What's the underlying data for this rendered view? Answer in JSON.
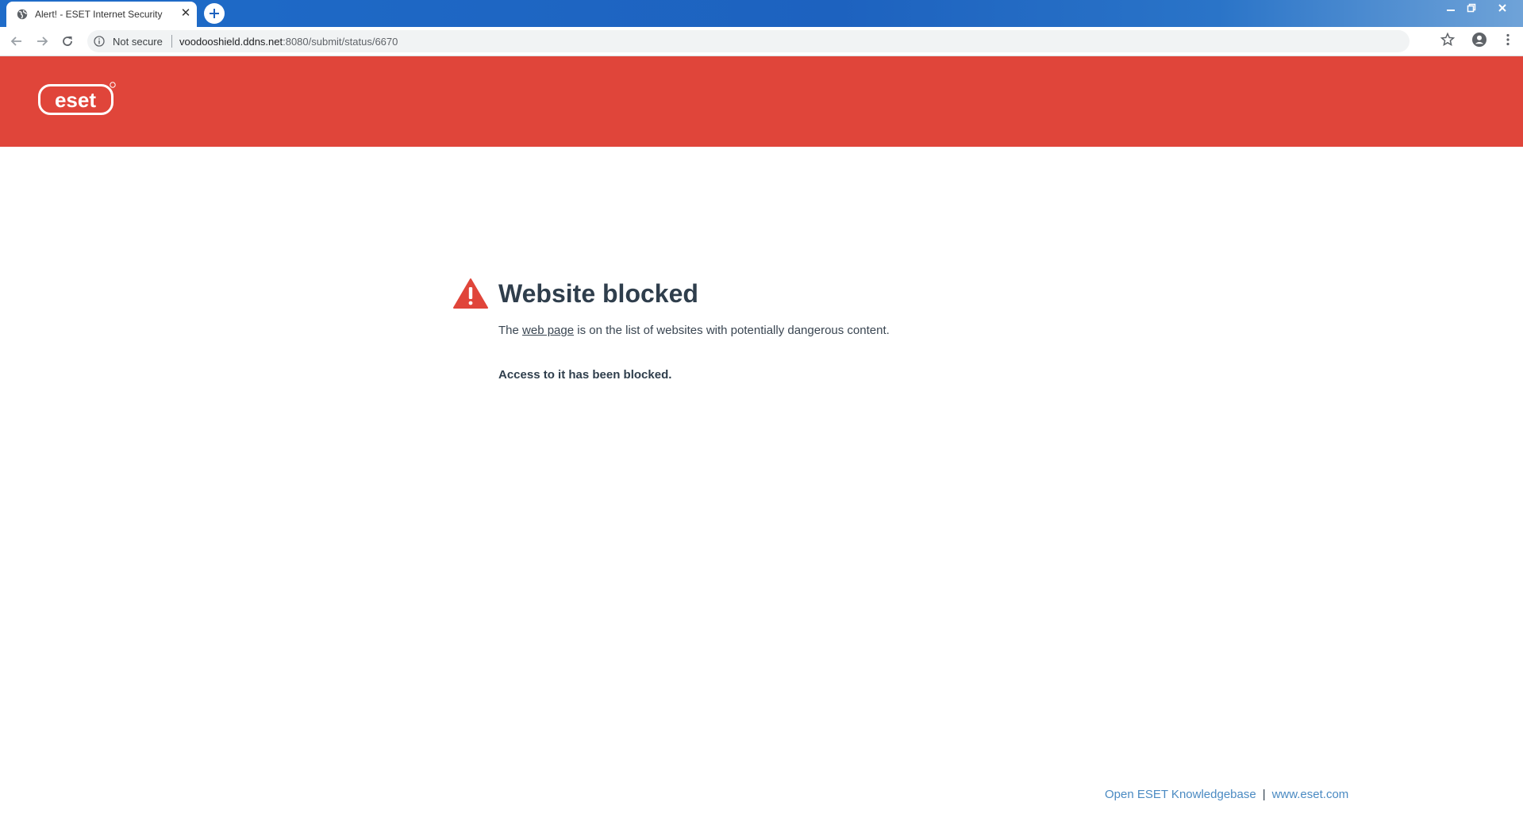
{
  "browser": {
    "tab_title": "Alert! - ESET Internet Security",
    "security_label": "Not secure",
    "url_host": "voodooshield.ddns.net",
    "url_path": ":8080/submit/status/6670"
  },
  "page": {
    "logo_text": "eset",
    "heading": "Website blocked",
    "desc_prefix": "The ",
    "desc_link": "web page",
    "desc_suffix": " is on the list of websites with potentially dangerous content.",
    "blocked_text": "Access to it has been blocked.",
    "footer": {
      "kb_link": "Open ESET Knowledgebase",
      "separator": "|",
      "site_link": "www.eset.com"
    }
  },
  "colors": {
    "brand_red": "#e0453a",
    "title_bar_blue": "#1f6cc9",
    "link_blue": "#4a8ac2",
    "text_dark": "#2f3e4c"
  },
  "icons": [
    "globe-icon",
    "close-icon",
    "plus-icon",
    "minimize-icon",
    "restore-icon",
    "window-close-icon",
    "back-arrow-icon",
    "forward-arrow-icon",
    "reload-icon",
    "info-icon",
    "star-icon",
    "profile-icon",
    "kebab-menu-icon",
    "warning-icon"
  ]
}
